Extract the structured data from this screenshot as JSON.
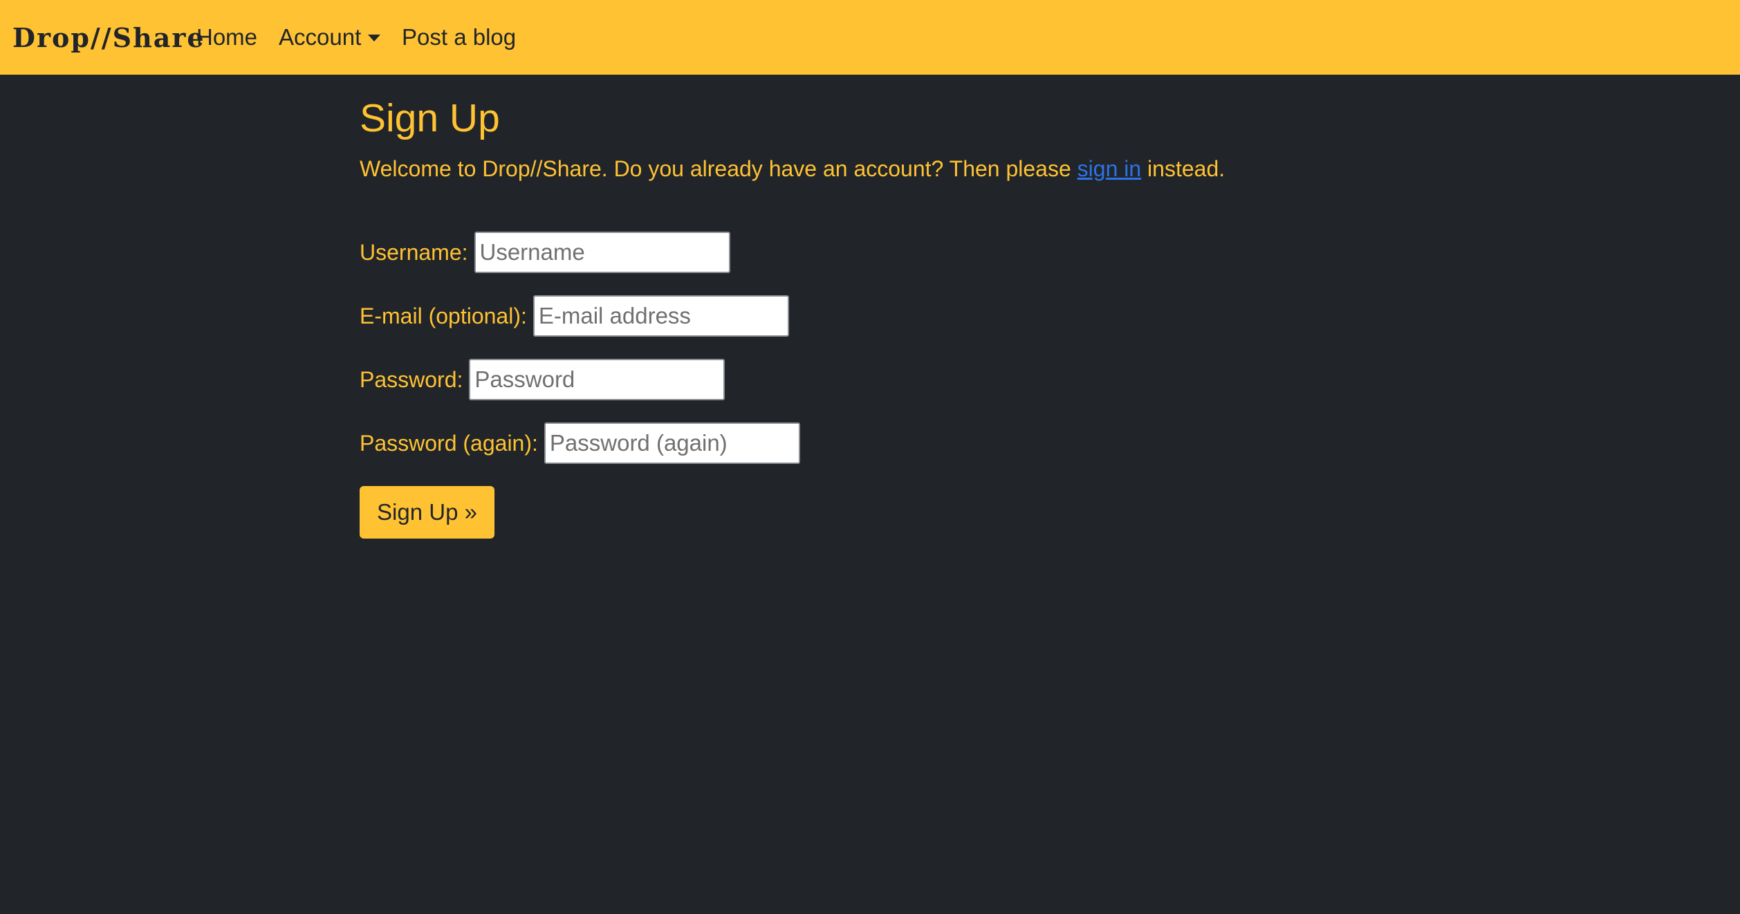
{
  "navbar": {
    "brand": "Drop//Share",
    "links": [
      {
        "label": "Home"
      },
      {
        "label": "Account"
      },
      {
        "label": "Post a blog"
      }
    ]
  },
  "page": {
    "title": "Sign Up",
    "intro_before": "Welcome to Drop//Share. Do you already have an account? Then please ",
    "intro_link": "sign in",
    "intro_after": " instead."
  },
  "form": {
    "fields": [
      {
        "label": "Username:",
        "placeholder": "Username",
        "value": ""
      },
      {
        "label": "E-mail (optional):",
        "placeholder": "E-mail address",
        "value": ""
      },
      {
        "label": "Password:",
        "placeholder": "Password",
        "value": ""
      },
      {
        "label": "Password (again):",
        "placeholder": "Password (again)",
        "value": ""
      }
    ],
    "submit_label": "Sign Up »"
  },
  "colors": {
    "accent": "#ffc233",
    "background": "#212529",
    "link": "#2c73e8"
  }
}
